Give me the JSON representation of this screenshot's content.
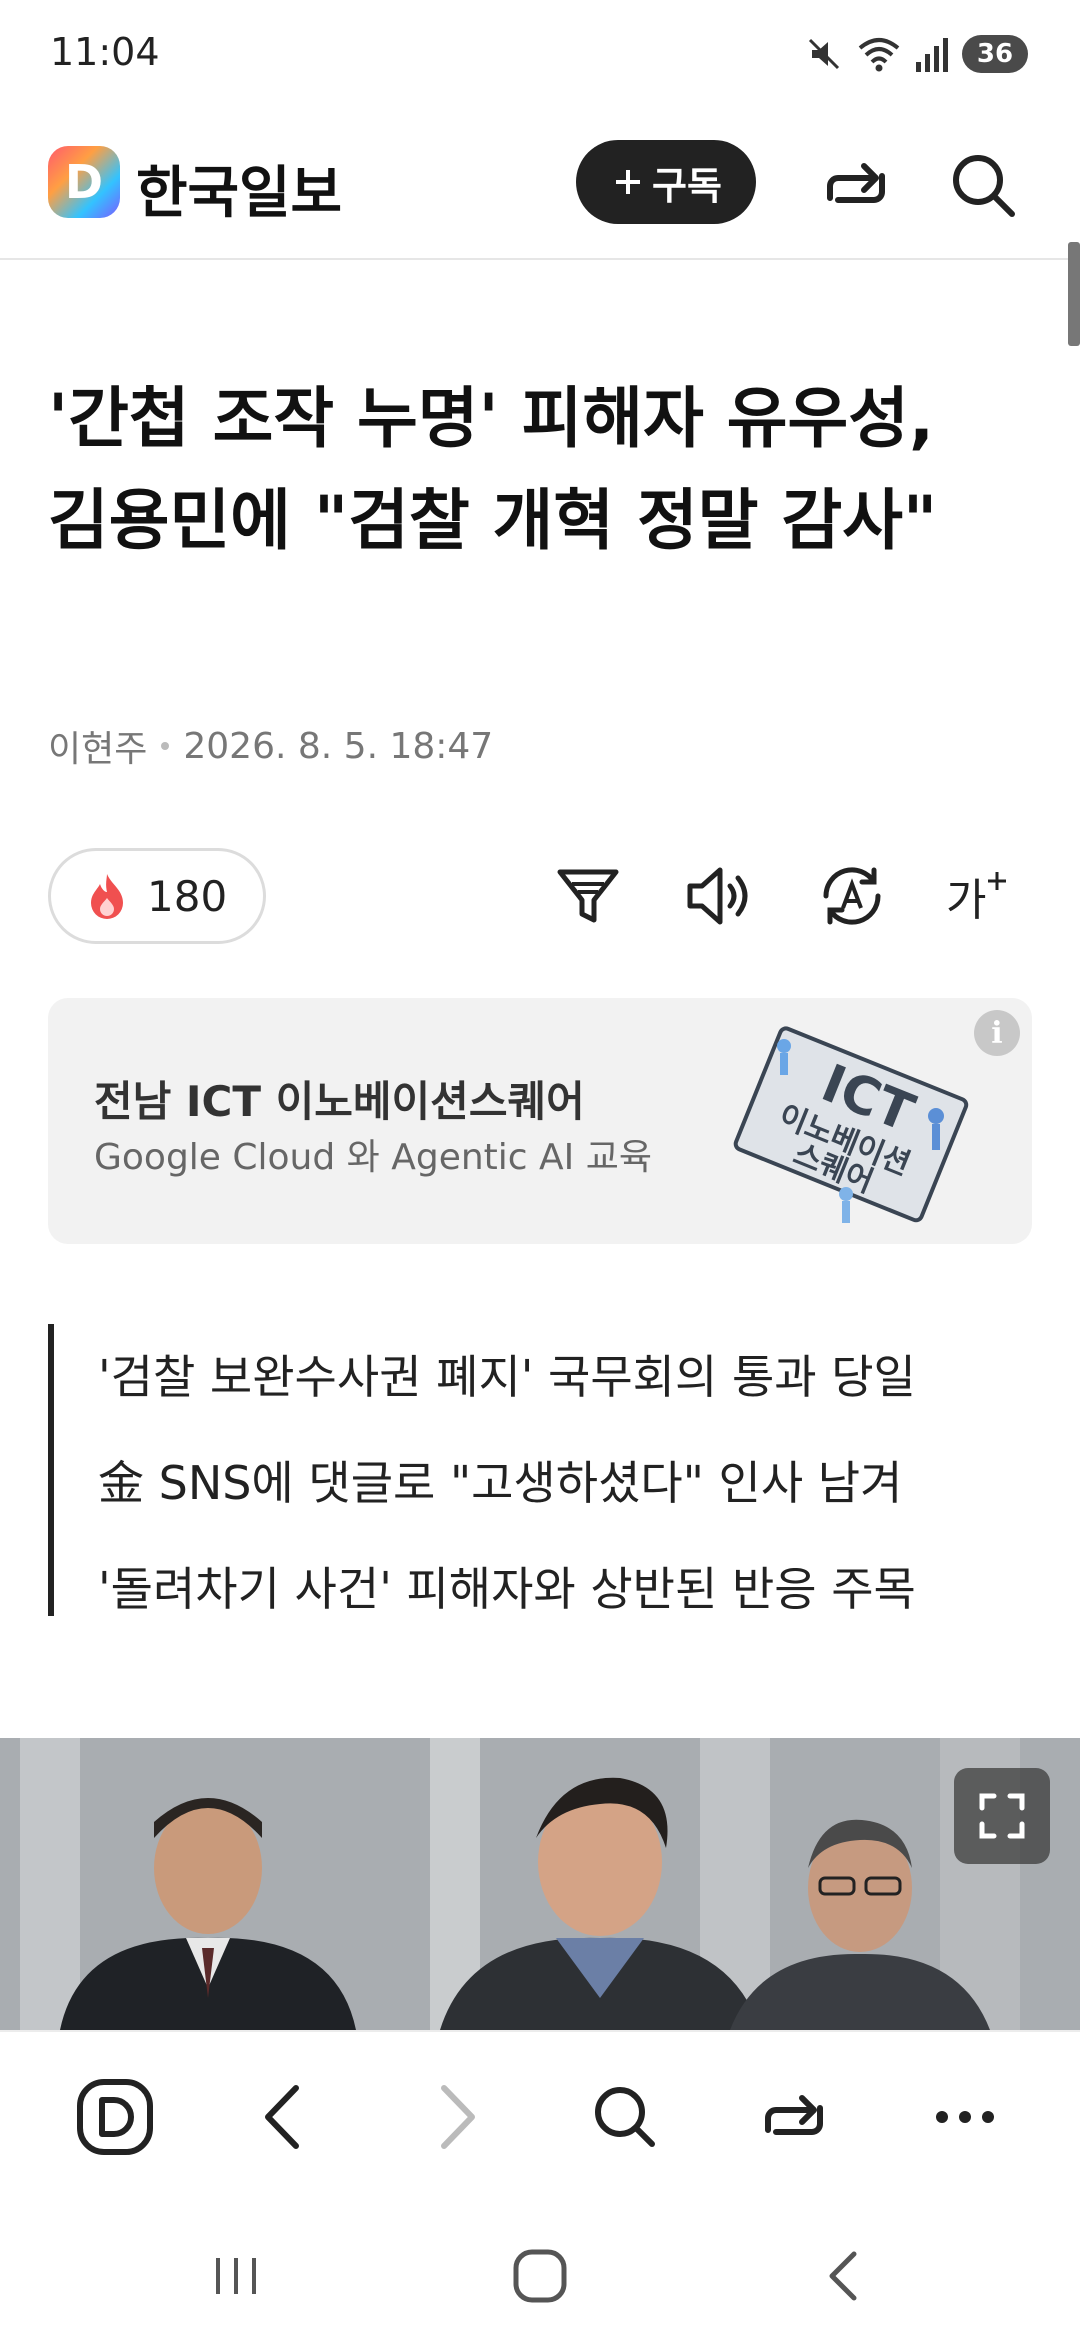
{
  "status_bar": {
    "time": "11:04",
    "battery": "36"
  },
  "header": {
    "logo_letter": "D",
    "brand": "한국일보",
    "subscribe_label": "구독",
    "subscribe_icon": "plus-icon"
  },
  "article": {
    "title": "'간첩 조작 누명' 피해자 유우성, 김용민에 \"검찰 개혁 정말 감사\"",
    "author": "이현주",
    "datetime": "2026. 8. 5. 18:47",
    "like_count": "180",
    "summary": [
      "'검찰 보완수사권 폐지' 국무회의 통과 당일",
      "金 SNS에 댓글로 \"고생하셨다\" 인사 남겨",
      "'돌려차기 사건' 피해자와 상반된 반응 주목"
    ]
  },
  "ad": {
    "title": "전남 ICT 이노베이션스퀘어",
    "subtitle": "Google Cloud 와 Agentic AI 교육",
    "info_glyph": "i",
    "art_text": "ICT 이노베이션 스퀘어"
  },
  "tools": {
    "font_size_label": "가"
  },
  "colors": {
    "accent_dark": "#222222",
    "flame": "#f05050"
  }
}
